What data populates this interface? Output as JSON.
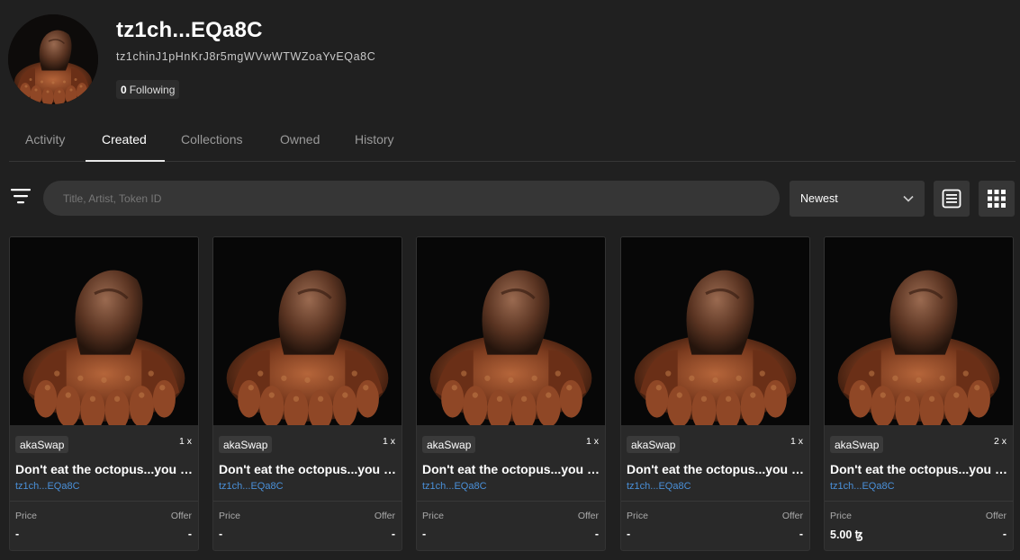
{
  "profile": {
    "name": "tz1ch...EQa8C",
    "address": "tz1chinJ1pHnKrJ8r5mgWVwWTWZoaYvEQa8C",
    "following_count": "0",
    "following_label": "Following"
  },
  "tabs": [
    {
      "label": "Activity",
      "active": false
    },
    {
      "label": "Created",
      "active": true
    },
    {
      "label": "Collections",
      "active": false
    },
    {
      "label": "Owned",
      "active": false
    },
    {
      "label": "History",
      "active": false
    }
  ],
  "toolbar": {
    "search_placeholder": "Title, Artist, Token ID",
    "sort_value": "Newest",
    "filter_icon": "filter-icon",
    "list_view_icon": "list-view-icon",
    "grid_view_icon": "grid-view-icon"
  },
  "cards": [
    {
      "platform": "akaSwap",
      "edition": "1 x",
      "title": "Don't eat the octopus...you damn...",
      "artist": "tz1ch...EQa8C",
      "price_label": "Price",
      "offer_label": "Offer",
      "price": "-",
      "offer": "-"
    },
    {
      "platform": "akaSwap",
      "edition": "1 x",
      "title": "Don't eat the octopus...you damn...",
      "artist": "tz1ch...EQa8C",
      "price_label": "Price",
      "offer_label": "Offer",
      "price": "-",
      "offer": "-"
    },
    {
      "platform": "akaSwap",
      "edition": "1 x",
      "title": "Don't eat the octopus...you damn...",
      "artist": "tz1ch...EQa8C",
      "price_label": "Price",
      "offer_label": "Offer",
      "price": "-",
      "offer": "-"
    },
    {
      "platform": "akaSwap",
      "edition": "1 x",
      "title": "Don't eat the octopus...you damn...",
      "artist": "tz1ch...EQa8C",
      "price_label": "Price",
      "offer_label": "Offer",
      "price": "-",
      "offer": "-"
    },
    {
      "platform": "akaSwap",
      "edition": "2 x",
      "title": "Don't eat the octopus...you damn...",
      "artist": "tz1ch...EQa8C",
      "price_label": "Price",
      "offer_label": "Offer",
      "price": "5.00 ꜩ",
      "offer": "-"
    }
  ],
  "colors": {
    "background": "#202020",
    "panel": "#363636",
    "card": "#292929",
    "link": "#4a90d9"
  }
}
